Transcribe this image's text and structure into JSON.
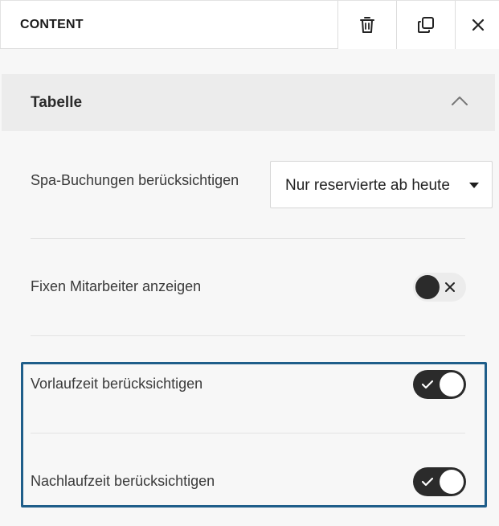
{
  "header": {
    "title": "CONTENT",
    "delete_icon": "trash-icon",
    "duplicate_icon": "copy-icon",
    "close_icon": "close-icon"
  },
  "section": {
    "title": "Tabelle",
    "chevron_icon": "chevron-up-icon",
    "expanded": true
  },
  "settings": {
    "spa": {
      "label": "Spa-Buchungen berücksichtigen",
      "selected": "Nur reservierte ab heute"
    },
    "fixed_staff": {
      "label": "Fixen Mitarbeiter anzeigen",
      "enabled": false
    },
    "lead_time": {
      "label": "Vorlaufzeit berücksichtigen",
      "enabled": true
    },
    "follow_time": {
      "label": "Nachlaufzeit berücksichtigen",
      "enabled": true
    }
  },
  "colors": {
    "highlight_border": "#1f5e8a",
    "toggle_dark": "#2b2b2b"
  }
}
